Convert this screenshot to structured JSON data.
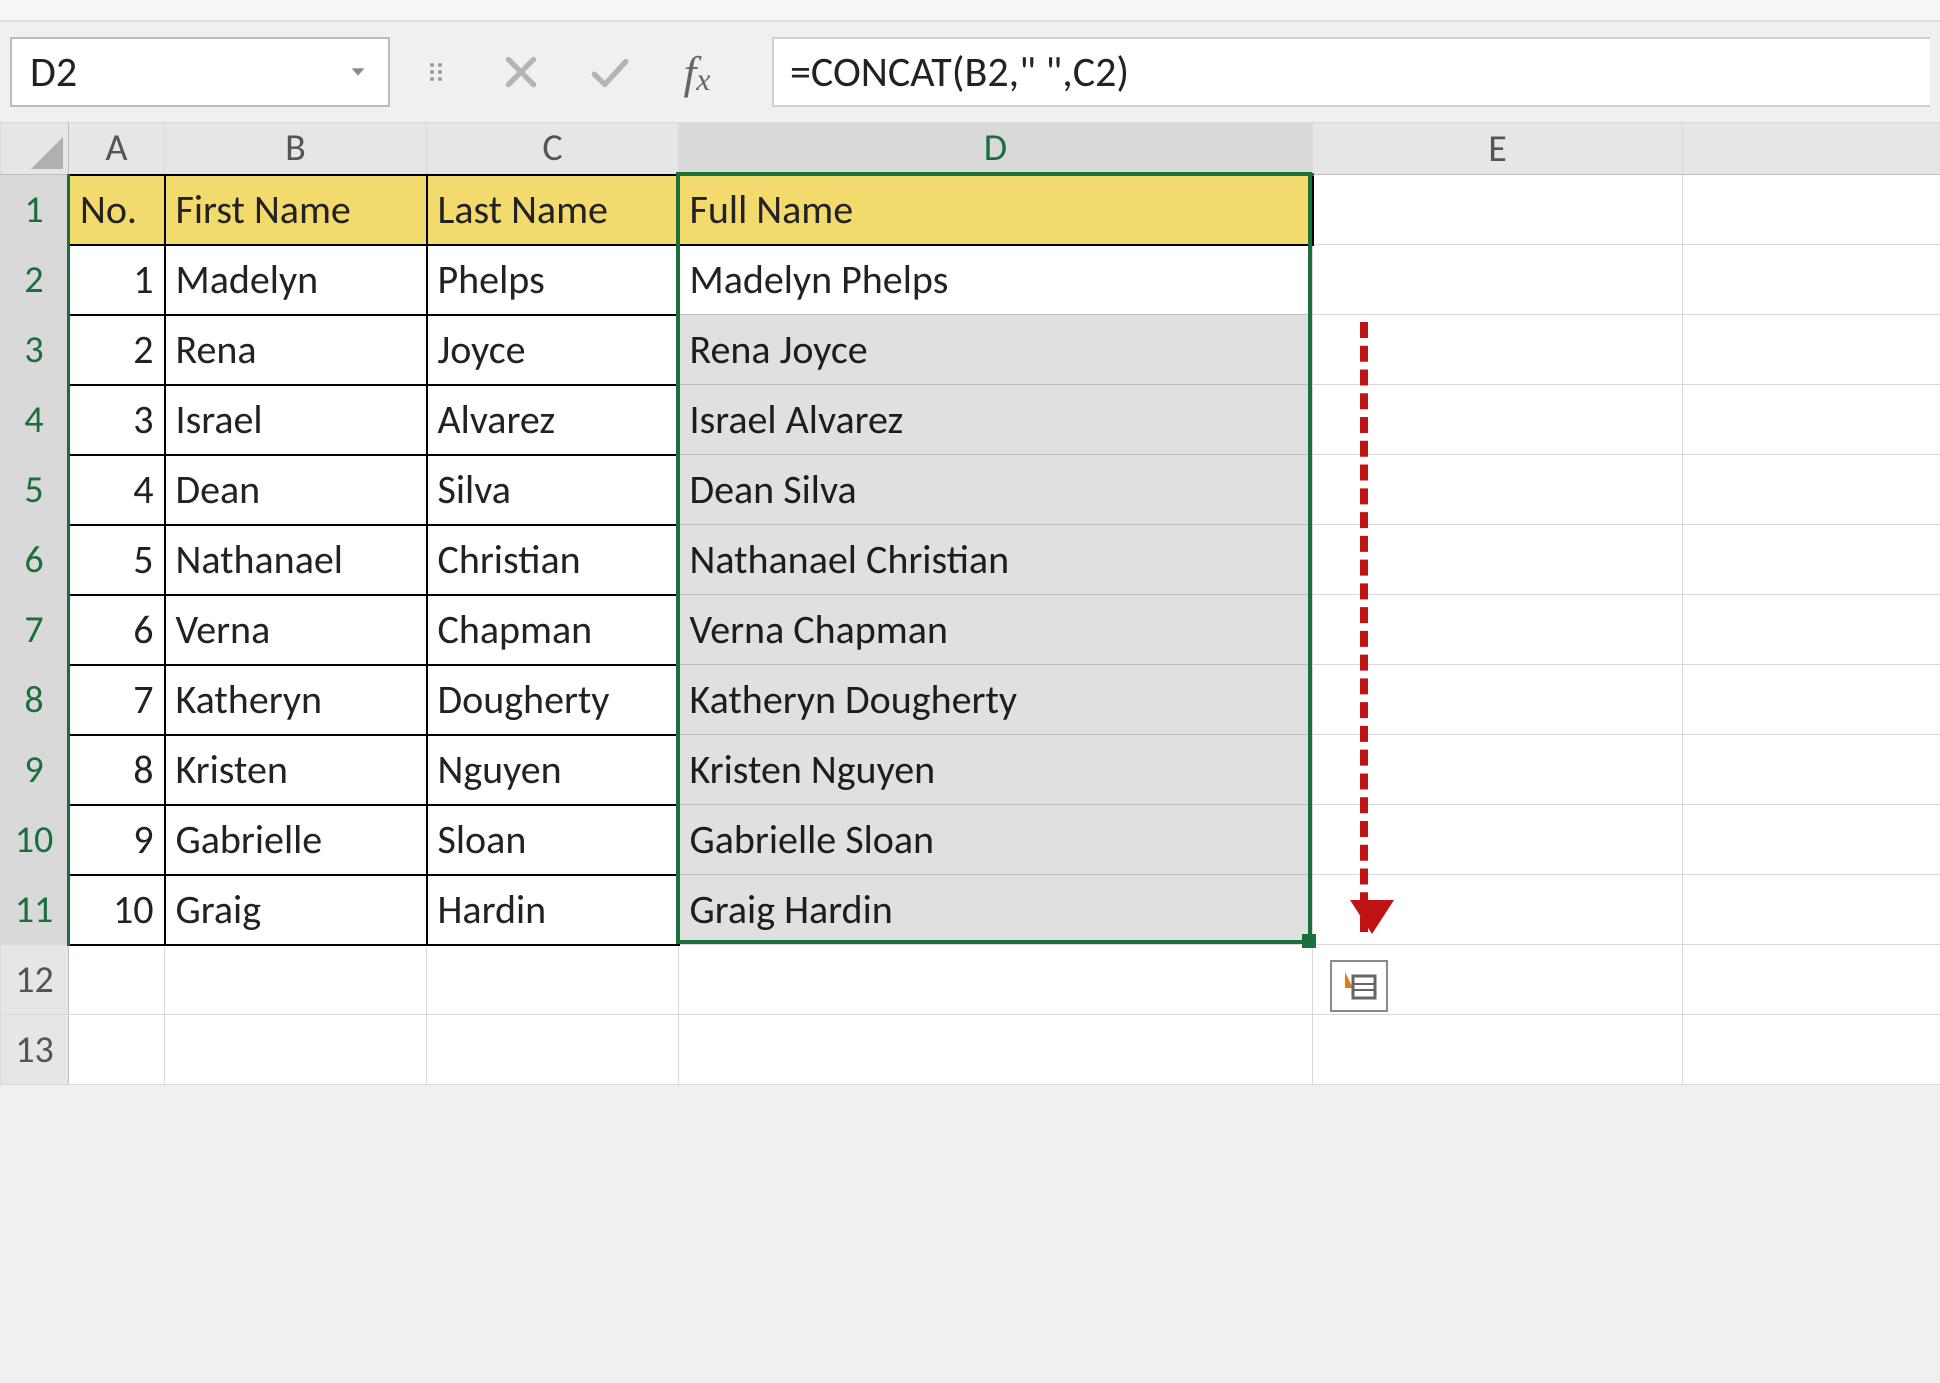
{
  "namebox": {
    "value": "D2"
  },
  "formula_bar": {
    "value": "=CONCAT(B2,\" \",C2)"
  },
  "columns": [
    "A",
    "B",
    "C",
    "D",
    "E"
  ],
  "row_headers": [
    "1",
    "2",
    "3",
    "4",
    "5",
    "6",
    "7",
    "8",
    "9",
    "10",
    "11",
    "12",
    "13"
  ],
  "selected_rows": [
    "1",
    "2",
    "3",
    "4",
    "5",
    "6",
    "7",
    "8",
    "9",
    "10",
    "11"
  ],
  "selected_col": "D",
  "header_row": {
    "A": "No.",
    "B": "First Name",
    "C": "Last Name",
    "D": "Full Name"
  },
  "data_rows": [
    {
      "no": "1",
      "first": "Madelyn",
      "last": "Phelps",
      "full": "Madelyn Phelps"
    },
    {
      "no": "2",
      "first": "Rena",
      "last": "Joyce",
      "full": "Rena Joyce"
    },
    {
      "no": "3",
      "first": "Israel",
      "last": "Alvarez",
      "full": "Israel Alvarez"
    },
    {
      "no": "4",
      "first": "Dean",
      "last": "Silva",
      "full": "Dean Silva"
    },
    {
      "no": "5",
      "first": "Nathanael",
      "last": "Christian",
      "full": "Nathanael Christian"
    },
    {
      "no": "6",
      "first": "Verna",
      "last": "Chapman",
      "full": "Verna Chapman"
    },
    {
      "no": "7",
      "first": "Katheryn",
      "last": "Dougherty",
      "full": "Katheryn Dougherty"
    },
    {
      "no": "8",
      "first": "Kristen",
      "last": "Nguyen",
      "full": "Kristen Nguyen"
    },
    {
      "no": "9",
      "first": "Gabrielle",
      "last": "Sloan",
      "full": "Gabrielle Sloan"
    },
    {
      "no": "10",
      "first": "Graig",
      "last": "Hardin",
      "full": "Graig Hardin"
    }
  ],
  "colors": {
    "selection_green": "#1b6f3a",
    "header_fill": "#f3da6d",
    "annotation_red": "#c01414"
  }
}
